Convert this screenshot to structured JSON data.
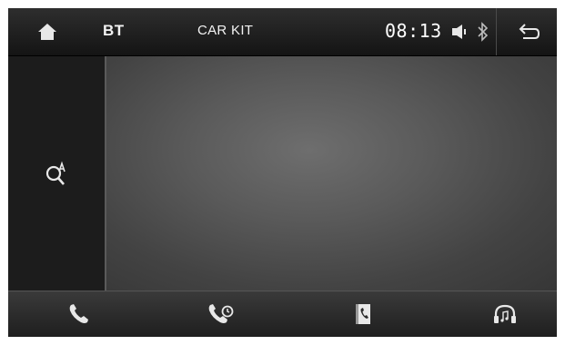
{
  "topbar": {
    "mode_label": "BT",
    "title": "CAR KIT",
    "clock": "08:13",
    "home_icon": "home-icon",
    "volume_icon": "volume-icon",
    "bluetooth_icon": "bluetooth-icon",
    "back_icon": "back-arrow-icon"
  },
  "sidepanel": {
    "search_icon": "search-contact-icon"
  },
  "bottombar": {
    "items": [
      {
        "icon": "phone-icon"
      },
      {
        "icon": "recent-calls-icon"
      },
      {
        "icon": "phonebook-icon"
      },
      {
        "icon": "bt-music-icon"
      }
    ]
  },
  "colors": {
    "bar_top": "#2e2e2e",
    "panel": "#1c1c1c",
    "content_center": "#6e6e6e",
    "icon": "#e8e8e8"
  }
}
